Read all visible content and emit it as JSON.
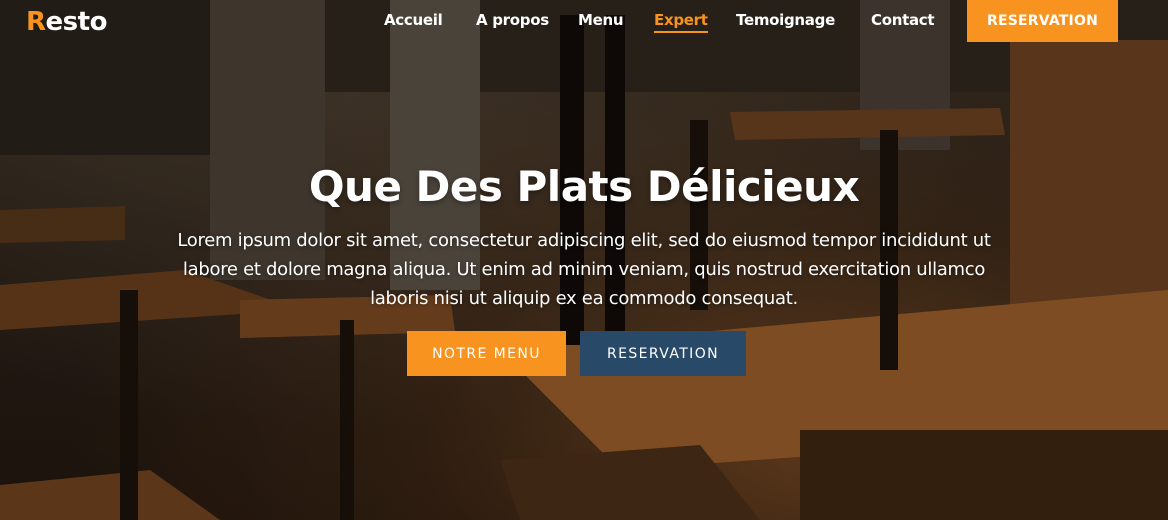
{
  "brand": {
    "first_letter": "R",
    "rest": "esto"
  },
  "nav": {
    "items": [
      {
        "label": "Accueil",
        "active": false
      },
      {
        "label": "A propos",
        "active": false
      },
      {
        "label": "Menu",
        "active": false
      },
      {
        "label": "Expert",
        "active": true
      },
      {
        "label": "Temoignage",
        "active": false
      },
      {
        "label": "Contact",
        "active": false
      }
    ],
    "cta_label": "RESERVATION"
  },
  "hero": {
    "title": "Que Des Plats Délicieux",
    "text": "Lorem ipsum dolor sit amet, consectetur adipiscing elit, sed do eiusmod tempor incididunt ut labore et dolore magna aliqua. Ut enim ad minim veniam, quis nostrud exercitation ullamco laboris nisi ut aliquip ex ea commodo consequat.",
    "primary_button": "NOTRE MENU",
    "secondary_button": "RESERVATION"
  },
  "colors": {
    "accent": "#f7931e",
    "secondary": "#294968",
    "text": "#ffffff"
  }
}
